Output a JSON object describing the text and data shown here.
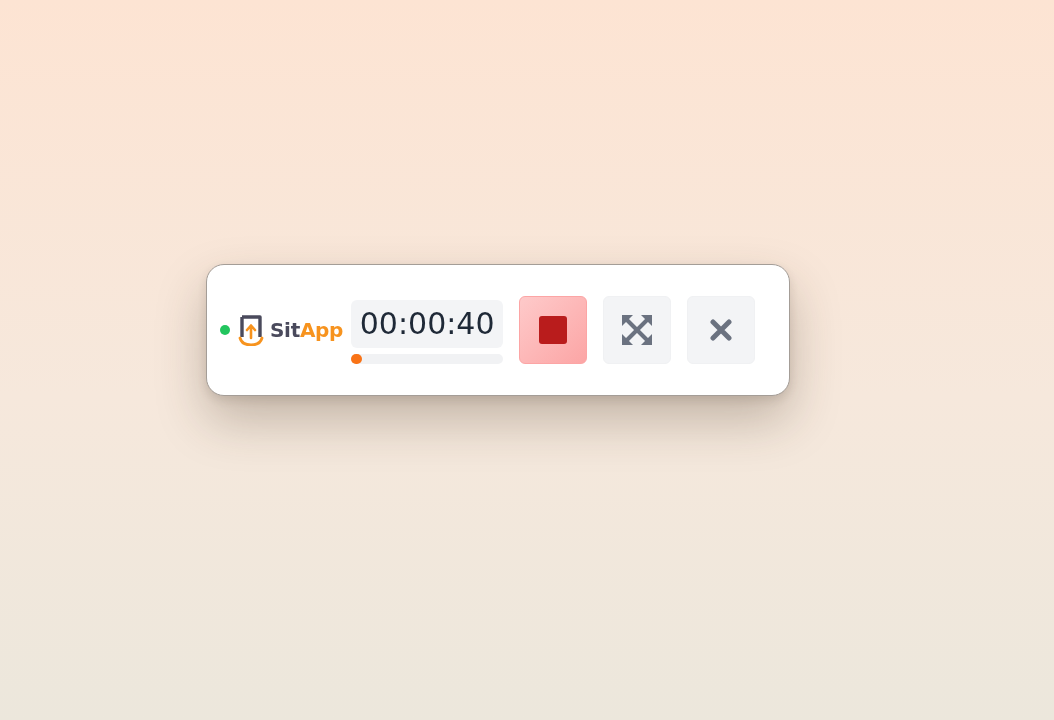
{
  "recording_indicator": {
    "on": true
  },
  "logo": {
    "wordmark": [
      "Sit",
      "App"
    ]
  },
  "timer": {
    "elapsed": "00:00:40",
    "level": 0.07
  },
  "buttons": [
    {
      "kind": "stop"
    },
    {
      "kind": "expand"
    },
    {
      "kind": "close"
    }
  ]
}
